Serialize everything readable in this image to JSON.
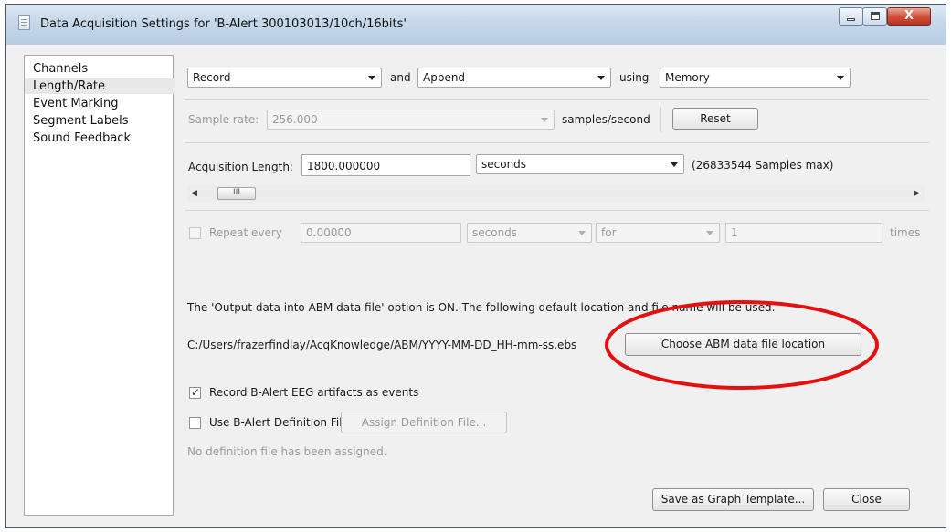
{
  "window": {
    "title": "Data Acquisition Settings for 'B-Alert 300103013/10ch/16bits'",
    "close_glyph": "X"
  },
  "sidebar": {
    "items": [
      {
        "label": "Channels",
        "selected": false
      },
      {
        "label": "Length/Rate",
        "selected": true
      },
      {
        "label": "Event Marking",
        "selected": false
      },
      {
        "label": "Segment Labels",
        "selected": false
      },
      {
        "label": "Sound Feedback",
        "selected": false
      }
    ]
  },
  "record_row": {
    "mode": "Record",
    "and_label": "and",
    "append": "Append",
    "using_label": "using",
    "storage": "Memory"
  },
  "sample_rate": {
    "label": "Sample rate:",
    "value": "256.000",
    "units": "samples/second",
    "reset_label": "Reset"
  },
  "acquisition": {
    "label": "Acquisition Length:",
    "value": "1800.000000",
    "units": "seconds",
    "max_note": "(26833544 Samples max)",
    "scroll_thumb": "III"
  },
  "repeat": {
    "label": "Repeat every",
    "value": "0.00000",
    "units": "seconds",
    "for_label": "for",
    "count": "1",
    "times_label": "times",
    "checked": false
  },
  "abm": {
    "notice": "The 'Output data into ABM data file' option is ON. The following default location and file name will be used.",
    "path": "C:/Users/frazerfindlay/AcqKnowledge/ABM/YYYY-MM-DD_HH-mm-ss.ebs",
    "choose_label": "Choose ABM data file location"
  },
  "options": {
    "record_artifacts_label": "Record B-Alert EEG artifacts as events",
    "record_artifacts_checked": true,
    "definition_label": "Use B-Alert Definition File",
    "definition_checked": false,
    "assign_label": "Assign Definition File...",
    "definition_status": "No definition file has been assigned."
  },
  "footer": {
    "save_template_label": "Save as Graph Template...",
    "close_label": "Close"
  },
  "annotation": {
    "ellipse_color": "#e41010"
  }
}
